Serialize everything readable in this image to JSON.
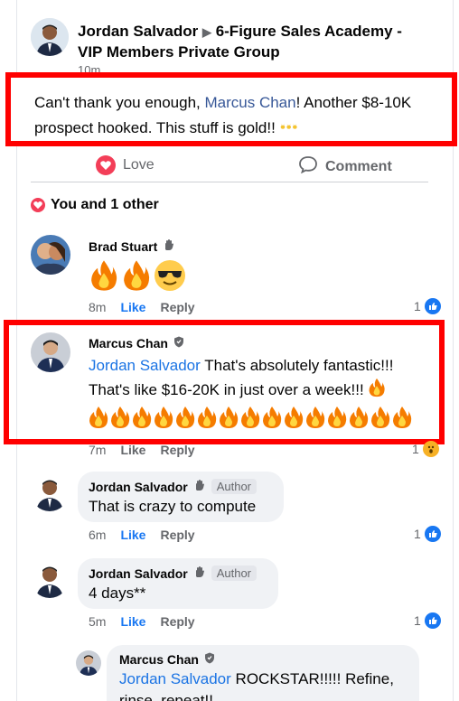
{
  "post": {
    "author": "Jordan Salvador",
    "group": "6-Figure Sales Academy - VIP Members Private Group",
    "time": "10m",
    "text_before": "Can't thank you enough, ",
    "mention": "Marcus Chan",
    "text_after": "!  Another $8-10K prospect hooked.  This stuff is gold!!"
  },
  "actions": {
    "love_label": "Love",
    "comment_label": "Comment"
  },
  "reactions_summary": "You and 1 other",
  "comments": [
    {
      "name": "Brad Stuart",
      "time": "8m",
      "like_label": "Like",
      "reply_label": "Reply",
      "reaction_count": "1"
    },
    {
      "name": "Marcus Chan",
      "mention": "Jordan Salvador",
      "line1": " That's absolutely fantastic!!!",
      "line2": "That's like $16-20K in just over a week!!!",
      "time": "7m",
      "like_label": "Like",
      "reply_label": "Reply",
      "reaction_count": "1"
    },
    {
      "name": "Jordan Salvador",
      "badge": "Author",
      "text": "That is crazy to compute",
      "time": "6m",
      "like_label": "Like",
      "reply_label": "Reply",
      "reaction_count": "1"
    },
    {
      "name": "Jordan Salvador",
      "badge": "Author",
      "text": "4 days**",
      "time": "5m",
      "like_label": "Like",
      "reply_label": "Reply",
      "reaction_count": "1"
    },
    {
      "name": "Marcus Chan",
      "mention": "Jordan Salvador",
      "line1": " ROCKSTAR!!!!! Refine,",
      "line2": "rinse, repeat!!"
    }
  ],
  "colors": {
    "highlight": "#ff0000",
    "link": "#385898",
    "like_blue": "#1877f2",
    "love_red": "#f33e58"
  }
}
